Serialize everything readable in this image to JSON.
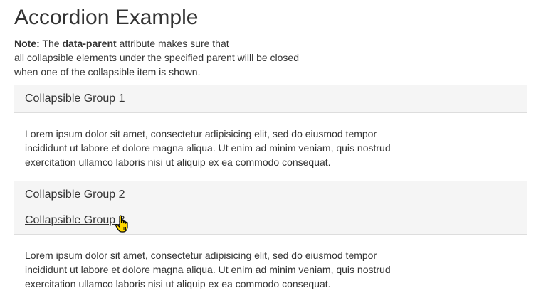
{
  "page": {
    "title": "Accordion Example",
    "note": {
      "prefix": "Note:",
      "text1": " The ",
      "attr": "data-parent",
      "text2": " attribute makes sure that",
      "line2": "all collapsible elements under the specified parent willl be closed",
      "line3": "when one of the collapsible item is shown."
    }
  },
  "accordion": {
    "groups": [
      {
        "title": "Collapsible Group 1",
        "body_lines": [
          "Lorem ipsum dolor sit amet, consectetur adipisicing elit, sed do eiusmod tempor",
          "incididunt ut labore et dolore magna aliqua. Ut enim ad minim veniam, quis nostrud",
          "exercitation ullamco laboris nisi ut aliquip ex ea commodo consequat."
        ]
      },
      {
        "title": "Collapsible Group 2"
      },
      {
        "title": "Collapsible Group 3",
        "body_lines": [
          "Lorem ipsum dolor sit amet, consectetur adipisicing elit, sed do eiusmod tempor",
          "incididunt ut labore et dolore magna aliqua. Ut enim ad minim veniam, quis nostrud",
          "exercitation ullamco laboris nisi ut aliquip ex ea commodo consequat."
        ]
      }
    ]
  },
  "cursor": {
    "icon": "hand-pointer-icon",
    "color": "#ffd700"
  }
}
